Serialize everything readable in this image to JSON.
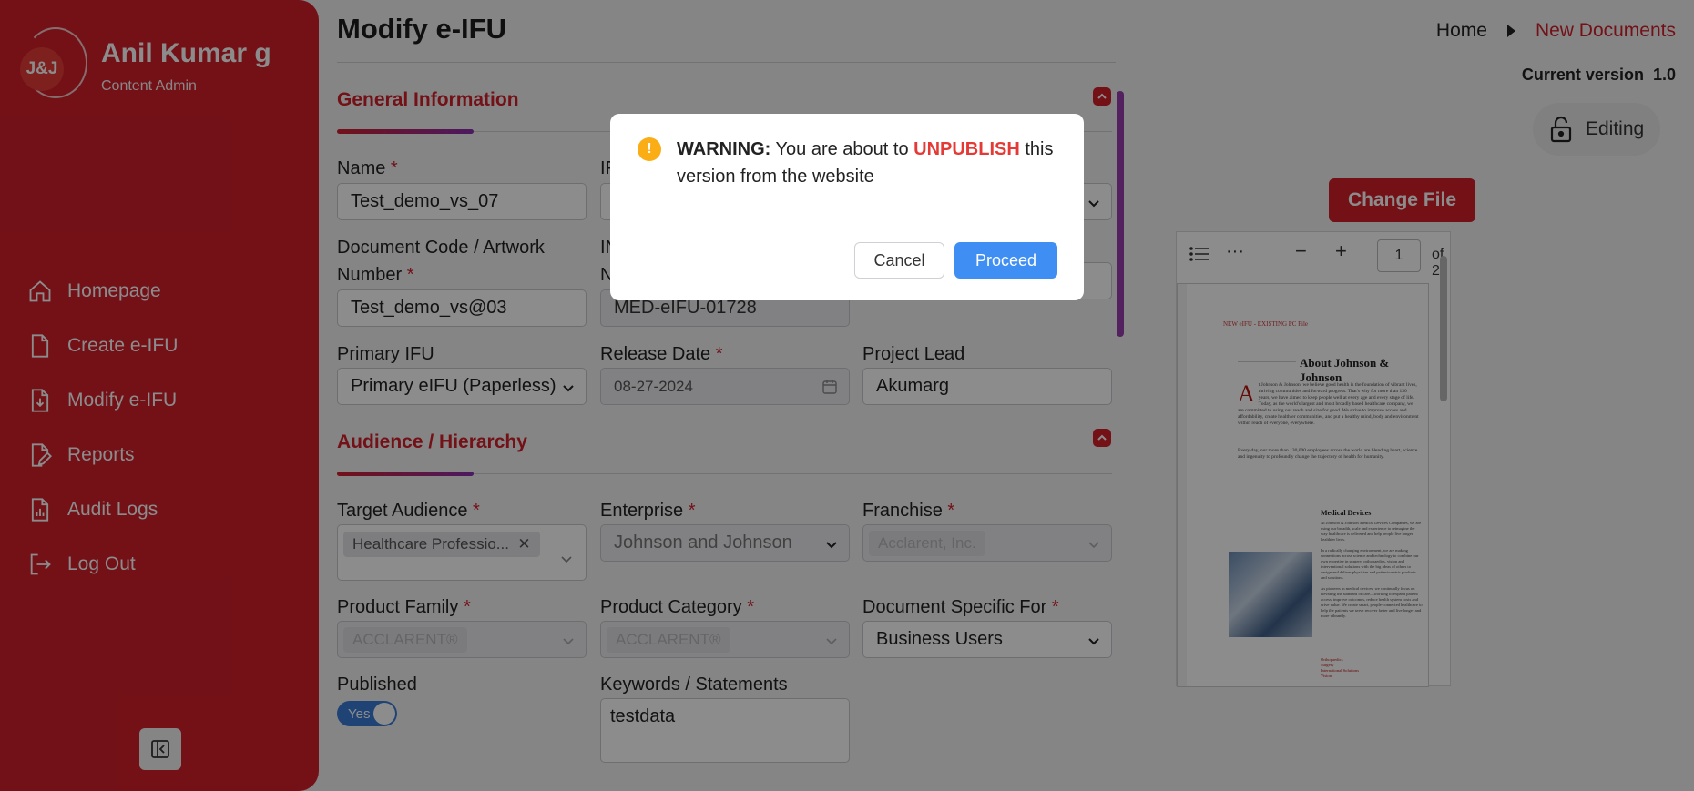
{
  "sidebar": {
    "logo_text": "J&J",
    "user_name": "Anil Kumar g",
    "user_role": "Content Admin",
    "items": [
      {
        "label": "Homepage",
        "icon": "home-icon"
      },
      {
        "label": "Create e-IFU",
        "icon": "file-icon"
      },
      {
        "label": "Modify e-IFU",
        "icon": "file-download-icon"
      },
      {
        "label": "Reports",
        "icon": "file-edit-icon"
      },
      {
        "label": "Audit Logs",
        "icon": "file-chart-icon"
      },
      {
        "label": "Log Out",
        "icon": "logout-icon"
      }
    ]
  },
  "header": {
    "title": "Modify e-IFU",
    "breadcrumb": {
      "home": "Home",
      "current": "New Documents"
    },
    "version_label": "Current version",
    "version_value": "1.0"
  },
  "general": {
    "title": "General Information",
    "name_label": "Name",
    "name_value": "Test_demo_vs_07",
    "ifu_label": "IF",
    "doc_code_label_1": "Document Code / Artwork",
    "doc_code_label_2": "Number",
    "doc_code_value": "Test_demo_vs@03",
    "in_label_1": "IN",
    "in_label_2": "N",
    "in_value": "MED-eIFU-01728",
    "primary_ifu_label": "Primary IFU",
    "primary_ifu_value": "Primary eIFU (Paperless)",
    "release_date_label": "Release Date",
    "release_date_value": "08-27-2024",
    "project_lead_label": "Project Lead",
    "project_lead_value": "Akumarg"
  },
  "audience": {
    "title": "Audience / Hierarchy",
    "target_audience_label": "Target Audience",
    "target_audience_value": "Healthcare Professio...",
    "enterprise_label": "Enterprise",
    "enterprise_value": "Johnson and Johnson",
    "franchise_label": "Franchise",
    "franchise_value": "Acclarent, Inc.",
    "product_family_label": "Product Family",
    "product_family_value": "ACCLARENT®",
    "product_category_label": "Product Category",
    "product_category_value": "ACCLARENT®",
    "doc_specific_label": "Document Specific For",
    "doc_specific_value": "Business Users",
    "published_label": "Published",
    "published_value": "Yes",
    "keywords_label": "Keywords / Statements",
    "keywords_value": "testdata"
  },
  "right": {
    "editing_label": "Editing",
    "change_file_label": "Change File",
    "pdf": {
      "page": "1",
      "of_pages": "of 2",
      "header_tag": "NEW eIFU - EXISTING PC File",
      "heading": "About Johnson & Johnson",
      "drop_cap": "A",
      "para1": "t Johnson & Johnson, we believe good health is the foundation of vibrant lives, thriving communities and forward progress. That's why for more than 130 years, we have aimed to keep people well at every age and every stage of life. Today, as the world's largest and most broadly based healthcare company, we are committed to using our reach and size for good. We strive to improve access and affordability, create healthier communities, and put a healthy mind, body and environment within reach of everyone, everywhere.",
      "para2": "Every day, our more than 130,000 employees across the world are blending heart, science and ingenuity to profoundly change the trajectory of health for humanity.",
      "subheading": "Medical Devices",
      "para3": "At Johnson & Johnson Medical Devices Companies, we are using our breadth, scale and experience to reimagine the way healthcare is delivered and help people live longer, healthier lives.",
      "para4": "In a radically changing environment, we are making connections across science and technology to combine our own expertise in surgery, orthopaedics, vision and interventional solutions with the big ideas of others to design and deliver physician and patient-centric products and solutions.",
      "para5": "As pioneers in medical devices, we continually focus on elevating the standard of care—working to expand patient access, improve outcomes, reduce health system costs and drive value. We create smart, people-connected healthcare to help the patients we serve recover faster and live longer and more vibrantly.",
      "links": [
        "Orthopaedics",
        "Surgery",
        "International Solutions",
        "Vision"
      ]
    }
  },
  "modal": {
    "warning_prefix": "WARNING:",
    "text_1": " You are about to ",
    "highlight": "UNPUBLISH",
    "text_2": " this version from the website",
    "cancel_label": "Cancel",
    "proceed_label": "Proceed",
    "icon_glyph": "!"
  },
  "colors": {
    "brand": "#d11f2b",
    "primary_button": "#3f8ef4",
    "warning": "#faad14"
  }
}
